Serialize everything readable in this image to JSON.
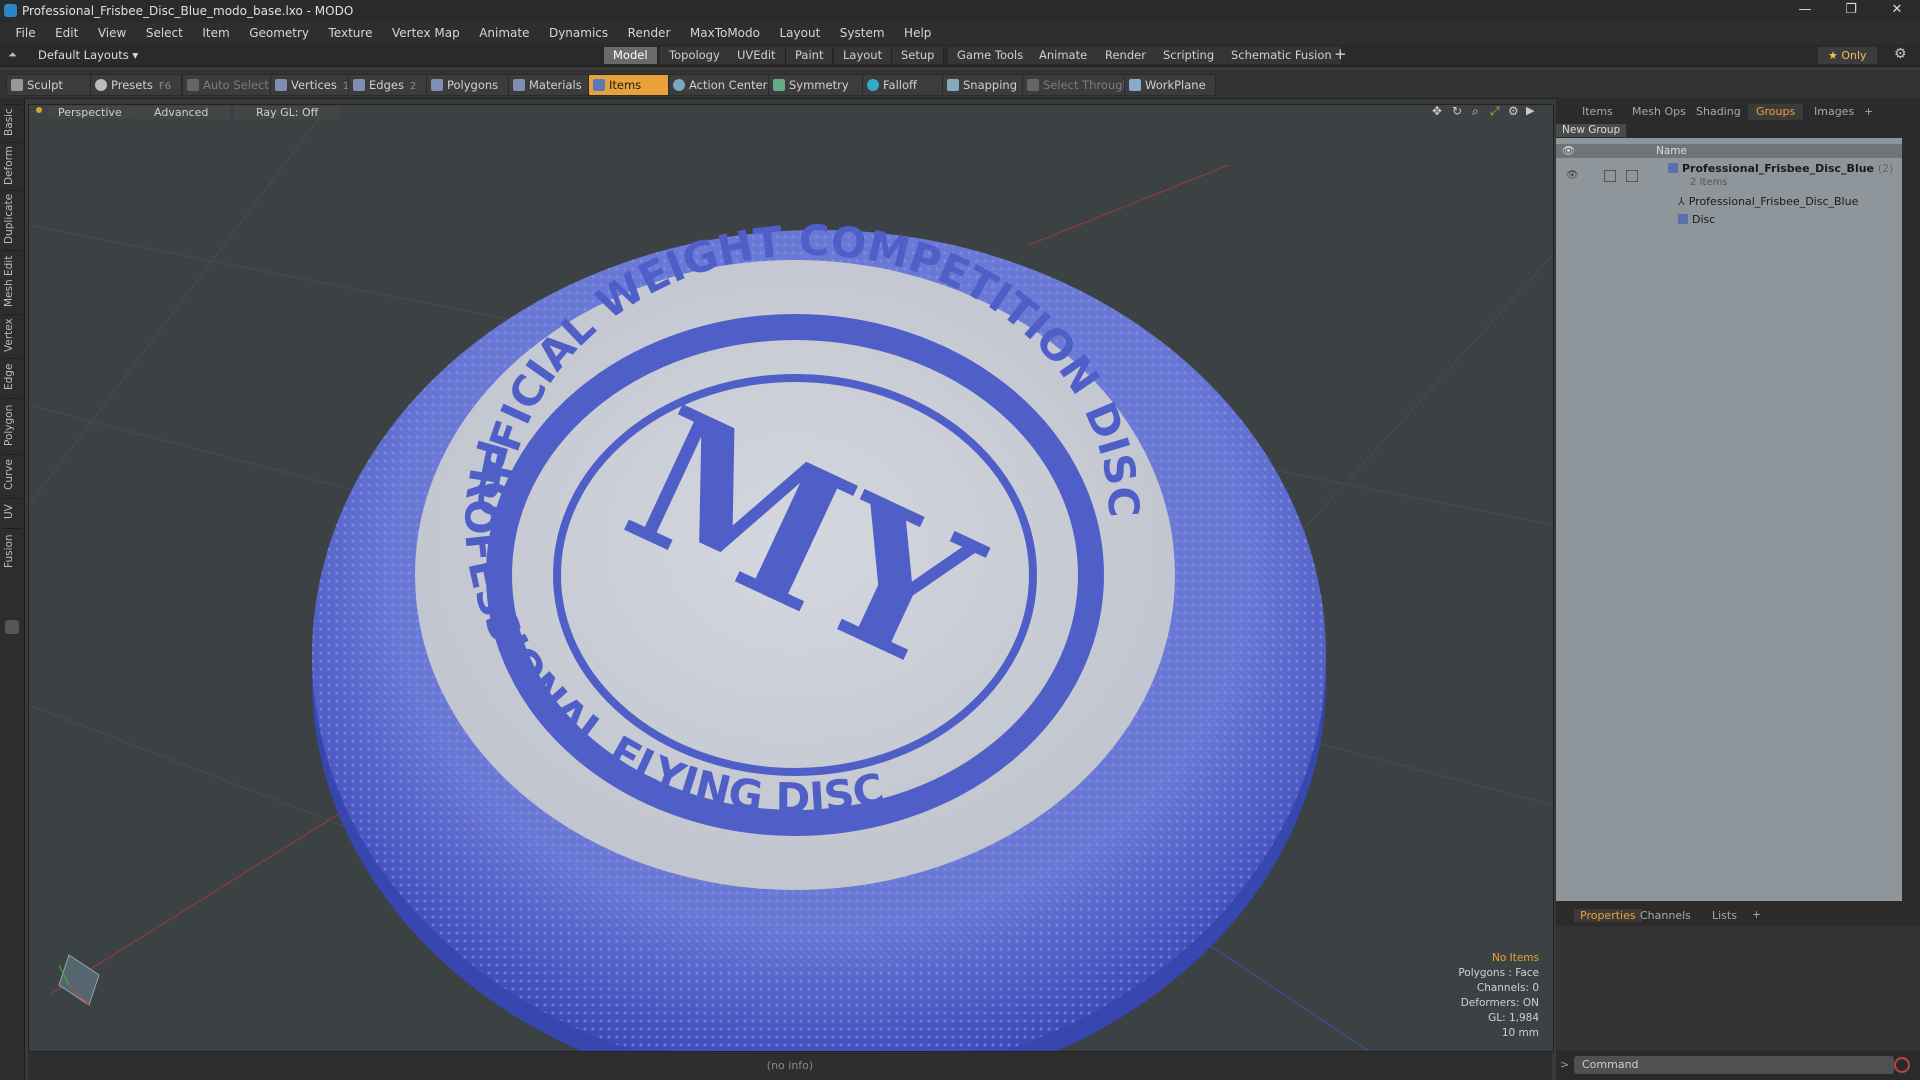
{
  "window": {
    "title": "Professional_Frisbee_Disc_Blue_modo_base.lxo - MODO",
    "controls": [
      "—",
      "❐",
      "✕"
    ]
  },
  "menu": [
    "File",
    "Edit",
    "View",
    "Select",
    "Item",
    "Geometry",
    "Texture",
    "Vertex Map",
    "Animate",
    "Dynamics",
    "Render",
    "MaxToModo",
    "Layout",
    "System",
    "Help"
  ],
  "layout_bar": {
    "preset": "Default Layouts ▾",
    "tabs": [
      "Model",
      "Topology",
      "UVEdit",
      "Paint",
      "Layout",
      "Setup",
      "Game Tools",
      "Animate",
      "Render",
      "Scripting",
      "Schematic Fusion"
    ],
    "active_tab": "Model",
    "add": "+",
    "only": "★  Only",
    "settings": "⚙"
  },
  "toolbar": {
    "sculpt": "Sculpt",
    "presets": "Presets",
    "presets_key": "F6",
    "auto_select": "Auto Select",
    "vertices": "Vertices",
    "vertices_count": "1",
    "edges": "Edges",
    "edges_count": "2",
    "polygons": "Polygons",
    "materials": "Materials",
    "items": "Items",
    "action_center": "Action Center",
    "symmetry": "Symmetry",
    "falloff": "Falloff",
    "snapping": "Snapping",
    "select_through": "Select Through",
    "workplane": "WorkPlane"
  },
  "left_tabs": [
    "Basic",
    "Deform",
    "Duplicate",
    "Mesh Edit",
    "Vertex",
    "Edge",
    "Polygon",
    "Curve",
    "UV",
    "Fusion"
  ],
  "viewport": {
    "view": "Perspective",
    "shading": "Advanced",
    "raygl": "Ray GL: Off",
    "disc_text_top": "OFFICIAL WEIGHT COMPETITION DISC",
    "disc_text_bottom": "PROFESSIONAL FLYING DISC",
    "logo": "MY",
    "status": {
      "items": "No Items",
      "polygons": "Polygons : Face",
      "channels": "Channels: 0",
      "deformers": "Deformers: ON",
      "gl": "GL: 1,984",
      "units": "10 mm"
    },
    "info": "(no info)"
  },
  "right_panel": {
    "tabs": [
      "Items",
      "Mesh Ops",
      "Shading",
      "Groups",
      "Images",
      "+"
    ],
    "active_tab": "Groups",
    "new_group": "New Group",
    "header_name": "Name",
    "group": {
      "name": "Professional_Frisbee_Disc_Blue",
      "count": "(2)",
      "sub": "2 Items",
      "children": [
        "Professional_Frisbee_Disc_Blue",
        "Disc"
      ]
    },
    "bottom_tabs": [
      "Properties",
      "Channels",
      "Lists",
      "+"
    ],
    "bottom_active": "Properties",
    "command_placeholder": "Command"
  },
  "colors": {
    "accent": "#f0a030",
    "disc_blue": "#4f5fc7",
    "disc_light": "#c7cad2"
  }
}
